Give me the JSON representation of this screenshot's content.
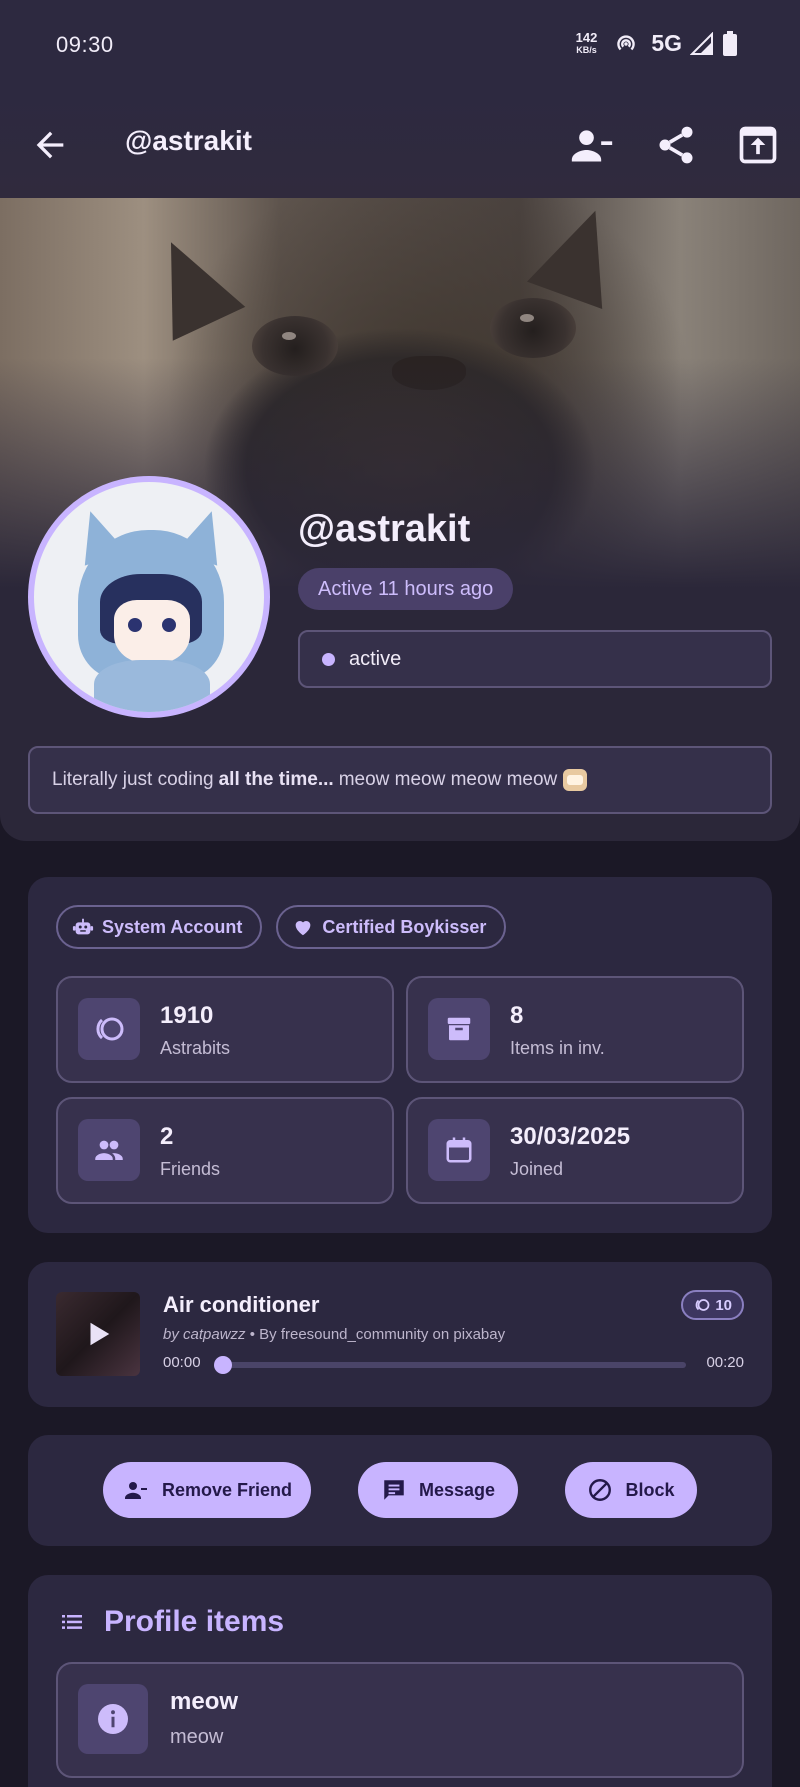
{
  "status_bar": {
    "time": "09:30",
    "net_speed": "142",
    "net_unit": "KB/s",
    "network": "5G"
  },
  "app_bar": {
    "title": "@astrakit",
    "icons": [
      "back-arrow-icon",
      "remove-friend-icon",
      "share-icon",
      "open-external-icon"
    ]
  },
  "profile": {
    "username": "@astrakit",
    "last_active": "Active 11 hours ago",
    "status": "active",
    "bio_prefix": "Literally just coding",
    "bio_bold": "all the time...",
    "bio_suffix": "meow meow meow meow"
  },
  "badges": [
    {
      "label": "System Account",
      "icon": "robot-icon"
    },
    {
      "label": "Certified Boykisser",
      "icon": "heart-icon"
    }
  ],
  "stats": [
    {
      "value": "1910",
      "label": "Astrabits",
      "icon": "astrabits-icon"
    },
    {
      "value": "8",
      "label": "Items in inv.",
      "icon": "archive-icon"
    },
    {
      "value": "2",
      "label": "Friends",
      "icon": "people-icon"
    },
    {
      "value": "30/03/2025",
      "label": "Joined",
      "icon": "calendar-icon"
    }
  ],
  "audio": {
    "title": "Air conditioner",
    "by": "by catpawzz",
    "source": "By freesound_community on pixabay",
    "price": "10",
    "elapsed": "00:00",
    "duration": "00:20",
    "progress": 0
  },
  "actions": [
    {
      "label": "Remove Friend",
      "icon": "remove-friend-icon"
    },
    {
      "label": "Message",
      "icon": "message-icon"
    },
    {
      "label": "Block",
      "icon": "block-icon"
    }
  ],
  "profile_items": {
    "heading": "Profile items",
    "items": [
      {
        "name": "meow",
        "description": "meow",
        "icon": "info-icon"
      }
    ]
  },
  "colors": {
    "accent": "#c8b4ff",
    "background": "#1b1826",
    "card": "#2c2840"
  }
}
